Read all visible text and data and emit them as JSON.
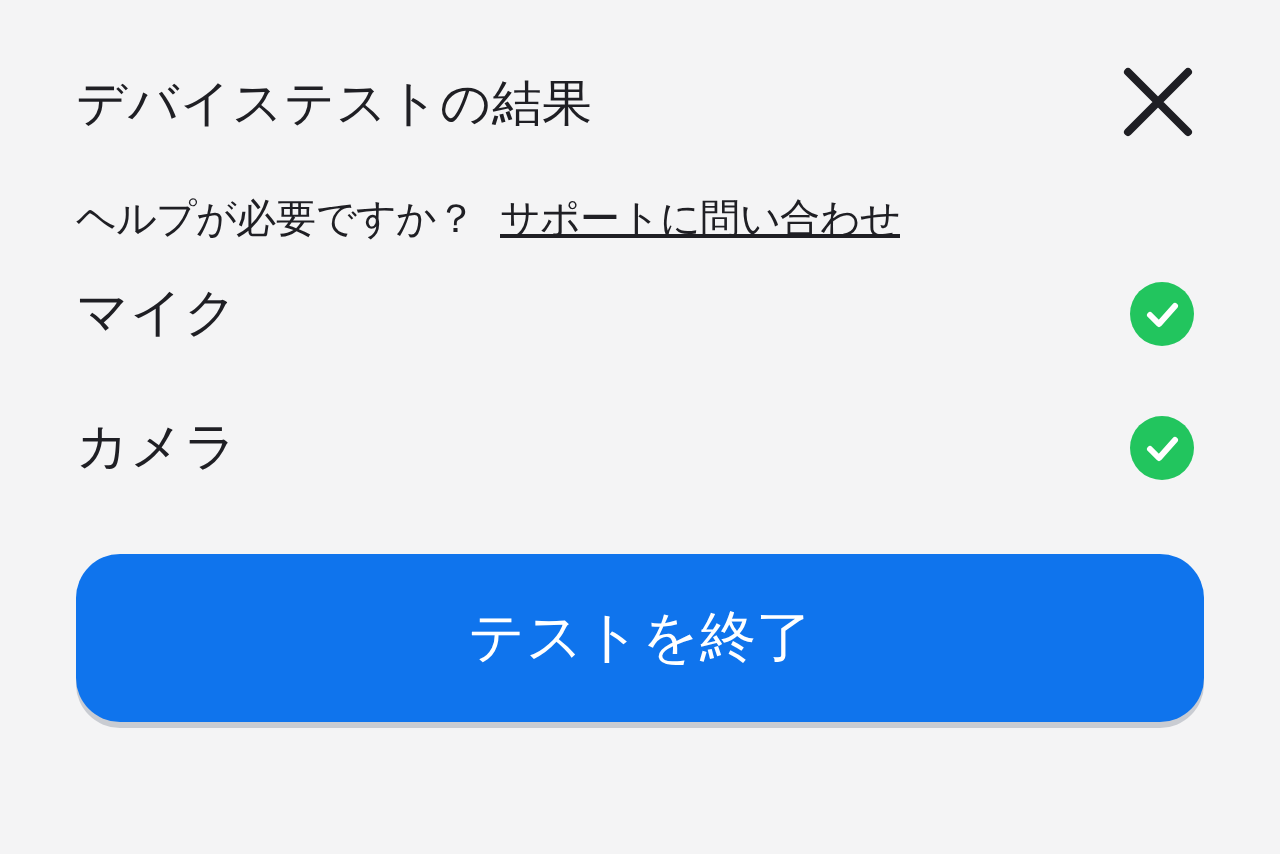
{
  "title": "デバイステストの結果",
  "help": {
    "text": "ヘルプが必要ですか？",
    "link": "サポートに問い合わせ"
  },
  "devices": [
    {
      "name": "マイク",
      "passed": true
    },
    {
      "name": "カメラ",
      "passed": true
    }
  ],
  "button": "テストを終了"
}
